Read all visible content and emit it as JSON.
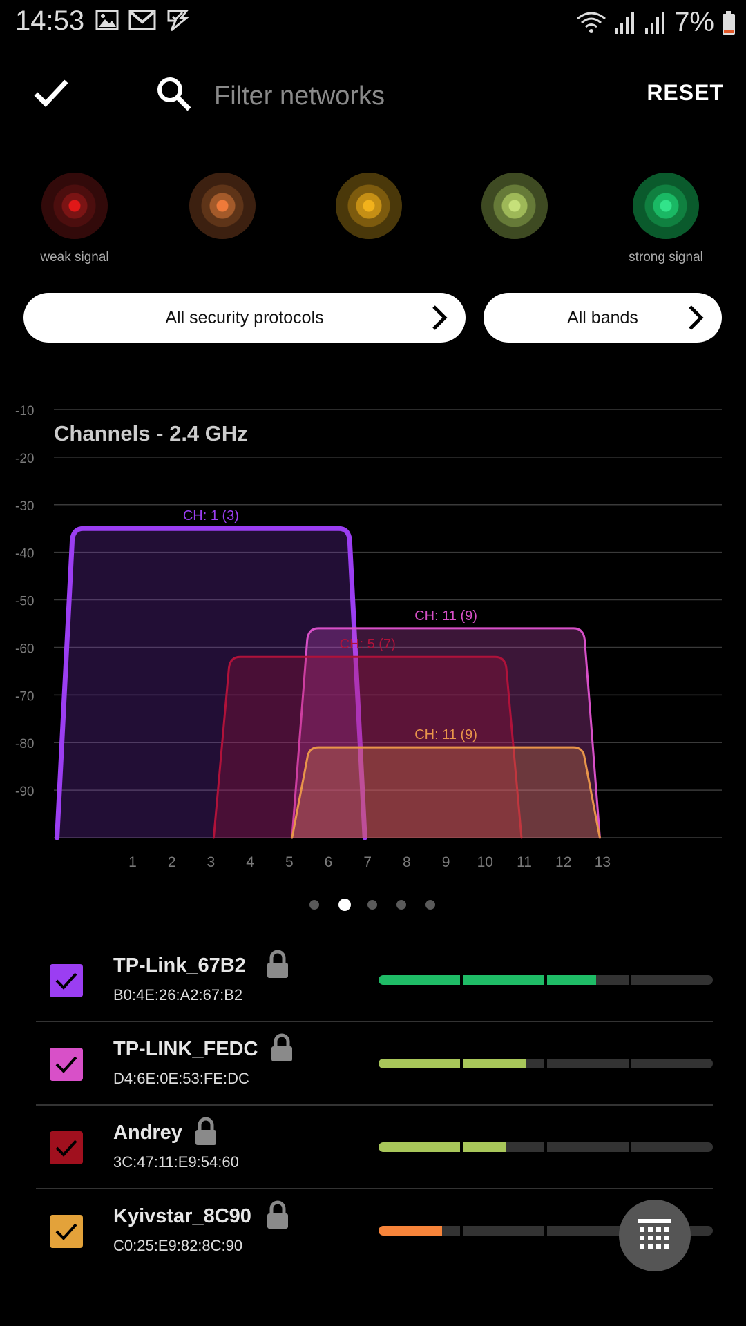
{
  "status_bar": {
    "time": "14:53",
    "battery": "7%",
    "left_icons": [
      "image-icon",
      "gmail-icon",
      "task-icon"
    ],
    "right_icons": [
      "wifi-icon",
      "cell-signal-icon",
      "cell-signal-icon",
      "battery-icon"
    ]
  },
  "toolbar": {
    "search_placeholder": "Filter networks",
    "reset_label": "RESET"
  },
  "signal_legend": {
    "weak_label": "weak signal",
    "strong_label": "strong signal",
    "colors": [
      "#c5262a",
      "#e07a3a",
      "#e8a81c",
      "#a8c65a",
      "#1fbb66"
    ]
  },
  "filters": {
    "security_label": "All security protocols",
    "bands_label": "All bands"
  },
  "chart_data": {
    "type": "area",
    "title": "Channels - 2.4 GHz",
    "xlabel": "",
    "ylabel": "",
    "x_ticks": [
      "1",
      "2",
      "3",
      "4",
      "5",
      "6",
      "7",
      "8",
      "9",
      "10",
      "11",
      "12",
      "13"
    ],
    "y_ticks": [
      "-10",
      "-20",
      "-30",
      "-40",
      "-50",
      "-60",
      "-70",
      "-80",
      "-90"
    ],
    "ylim": [
      -100,
      -10
    ],
    "grid": true,
    "series": [
      {
        "label": "CH: 1 (3)",
        "channel_from": -1,
        "channel_to": 7,
        "top_dbm": -35,
        "color": "#9b3ef2"
      },
      {
        "label": "CH: 11 (9)",
        "channel_from": 5,
        "channel_to": 13,
        "top_dbm": -56,
        "color": "#d850c8"
      },
      {
        "label": "CH: 5 (7)",
        "channel_from": 3,
        "channel_to": 11,
        "top_dbm": -62,
        "color": "#b0123a"
      },
      {
        "label": "CH: 11 (9)",
        "channel_from": 5,
        "channel_to": 13,
        "top_dbm": -81,
        "color": "#e8954a"
      }
    ]
  },
  "pager": {
    "count": 5,
    "active_index": 1
  },
  "networks": [
    {
      "ssid": "TP-Link_67B2",
      "mac": "B0:4E:26:A2:67:B2",
      "color": "#9b3ef2",
      "strength": 0.65,
      "bar_color": "#1fbb66"
    },
    {
      "ssid": "TP-LINK_FEDC",
      "mac": "D4:6E:0E:53:FE:DC",
      "color": "#d850c8",
      "strength": 0.44,
      "bar_color": "#a8c65a"
    },
    {
      "ssid": "Andrey",
      "mac": "3C:47:11:E9:54:60",
      "color": "#a0101e",
      "strength": 0.38,
      "bar_color": "#a8c65a"
    },
    {
      "ssid": "Kyivstar_8C90",
      "mac": "C0:25:E9:82:8C:90",
      "color": "#e3a23a",
      "strength": 0.19,
      "bar_color": "#f7843a"
    }
  ]
}
